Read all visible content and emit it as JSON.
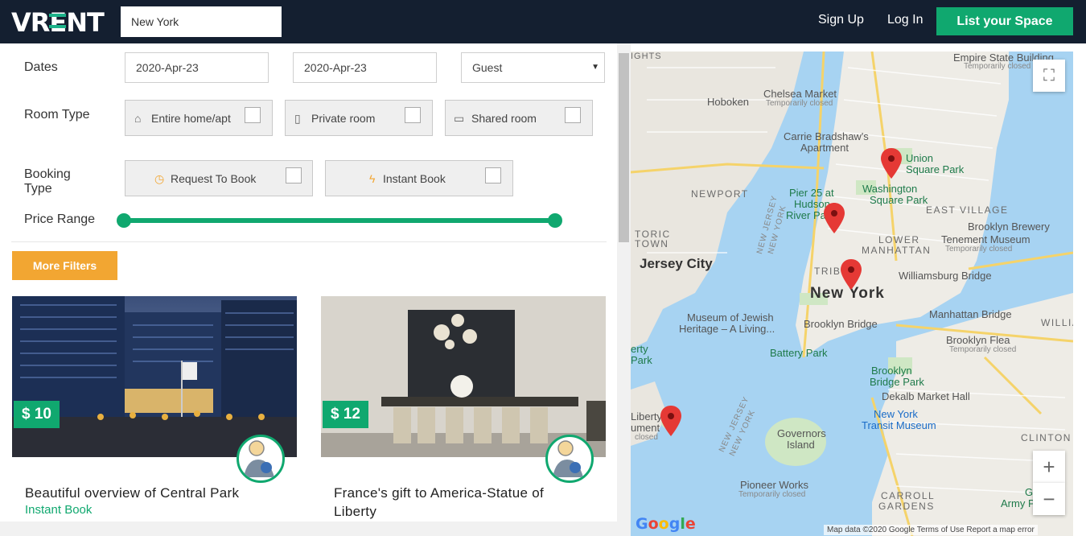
{
  "header": {
    "logo_left": "VR",
    "logo_mid": "E",
    "logo_right": "NT",
    "search_value": "New York",
    "signup": "Sign Up",
    "login": "Log In",
    "list_space": "List your Space"
  },
  "filters": {
    "dates_label": "Dates",
    "checkin": "2020-Apr-23",
    "checkout": "2020-Apr-23",
    "guest": "Guest",
    "room_type_label": "Room Type",
    "room_types": [
      "Entire home/apt",
      "Private room",
      "Shared room"
    ],
    "booking_type_label_1": "Booking",
    "booking_type_label_2": "Type",
    "booking_types": [
      "Request To Book",
      "Instant Book"
    ],
    "price_range_label": "Price Range",
    "more_filters": "More Filters"
  },
  "listings": [
    {
      "price": "$ 10",
      "title": "Beautiful overview of Central Park",
      "subtitle": "Instant Book"
    },
    {
      "price": "$ 12",
      "title": "France's gift to America-Statue of Liberty",
      "subtitle": ""
    }
  ],
  "map": {
    "labels": {
      "lights": "IGHTS",
      "hoboken": "Hoboken",
      "chelsea": "Chelsea Market",
      "chelsea_sub": "Temporarily closed",
      "esb": "Empire State Building",
      "esb_sub": "Temporarily closed",
      "carrie": "Carrie Bradshaw's",
      "carrie2": "Apartment",
      "union": "Union",
      "union2": "Square Park",
      "washington": "Washington",
      "washington2": "Square Park",
      "newport": "NEWPORT",
      "pier": "Pier 25 at",
      "pier2": "Hudson",
      "pier3": "River Park",
      "east_village": "EAST VILLAGE",
      "brooklyn_brewery": "Brooklyn Brewery",
      "historic": "TORIC",
      "historic2": "TOWN",
      "lower": "LOWER",
      "lower2": "MANHATTAN",
      "tenement": "Tenement Museum",
      "tenement_sub": "Temporarily closed",
      "jersey_city": "Jersey City",
      "williamsburg": "Williamsburg Bridge",
      "tribeca": "TRIB",
      "new_york": "New York",
      "museum_jewish": "Museum of Jewish",
      "museum_jewish2": "Heritage – A Living...",
      "manhattan_bridge": "Manhattan Bridge",
      "brooklyn_bridge": "Brooklyn Bridge",
      "williams": "WILLIA",
      "battery": "Battery Park",
      "liberty": "erty",
      "liberty2": "Park",
      "brooklyn_flea": "Brooklyn Flea",
      "brooklyn_flea_sub": "Temporarily closed",
      "bb_park": "Brooklyn",
      "bb_park2": "Bridge Park",
      "dekalb": "Dekalb Market Hall",
      "liberty_st": "Liberty",
      "liberty_st2": "ument",
      "liberty_st3": "closed",
      "ny_transit": "New York",
      "ny_transit2": "Transit Museum",
      "clinton": "CLINTON",
      "governors": "Governors",
      "governors2": "Island",
      "pioneer": "Pioneer Works",
      "pioneer_sub": "Temporarily closed",
      "carroll": "CARROLL",
      "carroll2": "GARDENS",
      "green": "Gre",
      "green2": "Army Pl",
      "nj_ny1": "NEW JERSEY",
      "nj_ny2": "NEW YORK",
      "nj_ny3": "NEW JERSEY",
      "nj_ny4": "NEW YORK"
    },
    "google": "Google",
    "attribution": "Map data ©2020 Google  Terms of Use  Report a map error",
    "zoom_in": "+",
    "zoom_out": "−"
  }
}
